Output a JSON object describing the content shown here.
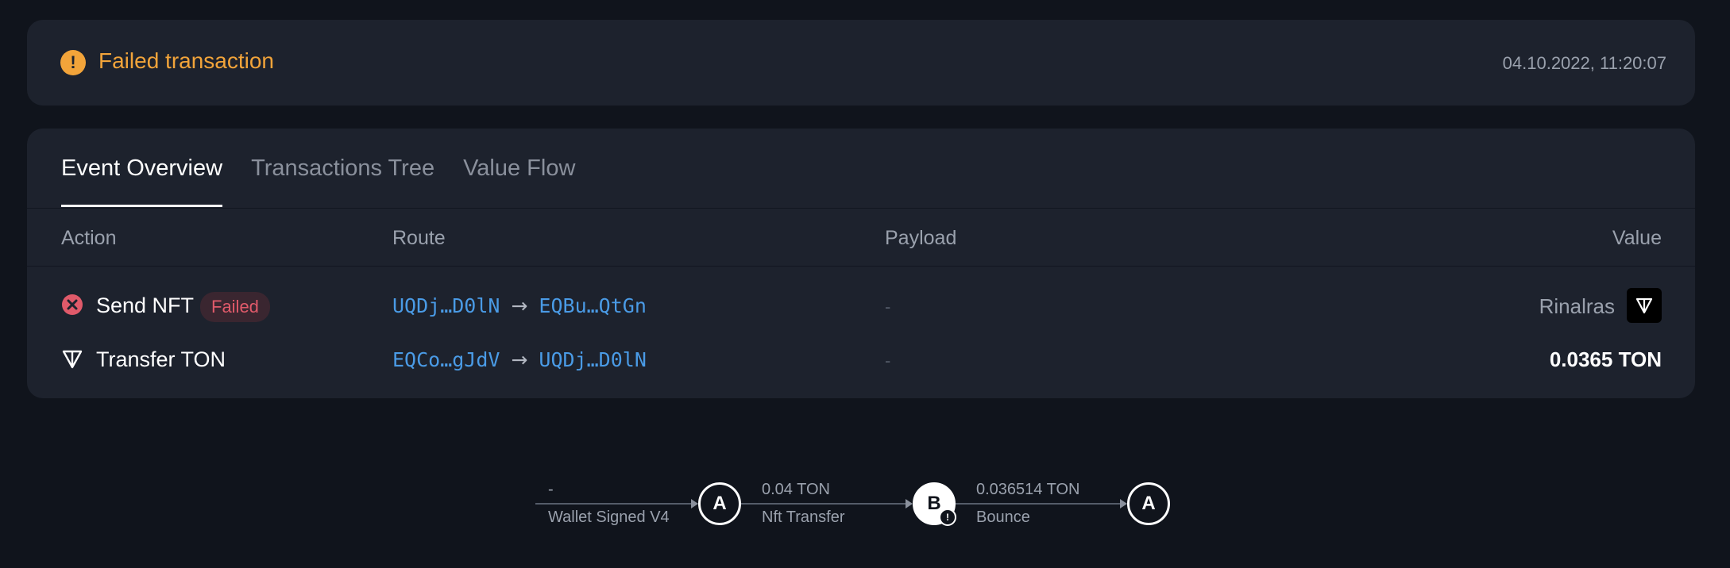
{
  "status": {
    "title": "Failed transaction",
    "timestamp": "04.10.2022, 11:20:07",
    "color": "#f2a43a"
  },
  "tabs": [
    {
      "label": "Event Overview",
      "active": true
    },
    {
      "label": "Transactions Tree",
      "active": false
    },
    {
      "label": "Value Flow",
      "active": false
    }
  ],
  "table": {
    "headers": {
      "action": "Action",
      "route": "Route",
      "payload": "Payload",
      "value": "Value"
    },
    "rows": [
      {
        "icon": "error-circle-icon",
        "action": "Send NFT",
        "badge": "Failed",
        "from": "UQDj…D0lN",
        "to": "EQBu…QtGn",
        "payload": "-",
        "value": "Rinalras",
        "value_icon": "nft-thumbnail"
      },
      {
        "icon": "ton-icon",
        "action": "Transfer TON",
        "from": "EQCo…gJdV",
        "to": "UQDj…D0lN",
        "payload": "-",
        "value": "0.0365 TON"
      }
    ]
  },
  "flow": {
    "edges": [
      {
        "top": "-",
        "bottom": "Wallet Signed V4"
      },
      {
        "top": "0.04 TON",
        "bottom": "Nft Transfer"
      },
      {
        "top": "0.036514 TON",
        "bottom": "Bounce"
      }
    ],
    "nodes": [
      {
        "label": "A",
        "filled": false,
        "warning": false
      },
      {
        "label": "B",
        "filled": true,
        "warning": true
      },
      {
        "label": "A",
        "filled": false,
        "warning": false
      }
    ]
  },
  "colors": {
    "link": "#4a9be6",
    "failed": "#e05a6a",
    "warning": "#f2a43a"
  }
}
